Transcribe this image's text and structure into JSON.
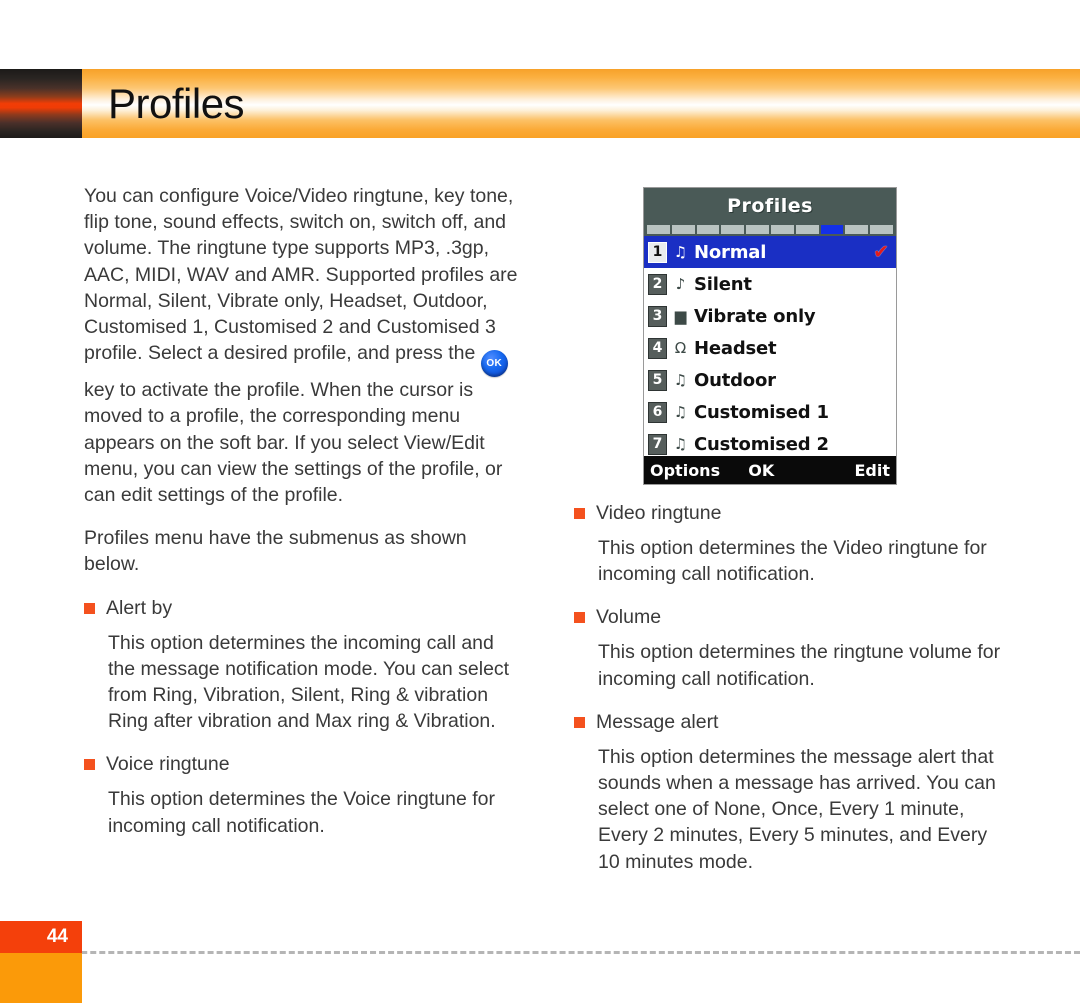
{
  "header": {
    "title": "Profiles"
  },
  "colors": {
    "accent_orange": "#fb9a09",
    "accent_red": "#f4400b",
    "bullet": "#f4511e",
    "phone_select": "#1a2fc4",
    "phone_title_bg": "#4a5a57",
    "check_red": "#e21b1b",
    "ok_key_blue": "#1769f0"
  },
  "left_column": {
    "intro_part1": "You can configure Voice/Video ringtune, key tone, flip tone, sound effects, switch on, switch off, and volume. The ringtune type supports MP3, .3gp, AAC, MIDI, WAV and AMR. Supported profiles are Normal, Silent, Vibrate only, Headset, Outdoor, Customised 1, Customised 2 and Customised 3 profile. Select a desired profile, and press the ",
    "ok_key_label": "OK",
    "intro_part2": " key to activate the profile. When the cursor is moved to a profile, the corresponding menu appears on the soft bar. If you select View/Edit menu, you can view the settings of the profile, or can edit settings of the profile.",
    "submenu_intro": "Profiles menu have the submenus as shown below.",
    "sections": [
      {
        "title": "Alert by",
        "body": "This option determines the incoming call and the message notification mode. You can select from Ring, Vibration, Silent, Ring & vibration Ring after vibration and Max ring & Vibration."
      },
      {
        "title": "Voice ringtune",
        "body": "This option determines the Voice ringtune for incoming call notification."
      }
    ]
  },
  "right_column": {
    "sections": [
      {
        "title": "Video ringtune",
        "body": "This option determines the Video ringtune for incoming call notification."
      },
      {
        "title": "Volume",
        "body": "This option determines the ringtune volume for incoming call notification."
      },
      {
        "title": "Message alert",
        "body": "This option determines the message alert that sounds when a message has arrived. You can select one of None, Once, Every 1 minute, Every 2 minutes, Every 5 minutes, and Every 10 minutes mode."
      }
    ]
  },
  "phone_screen": {
    "title": "Profiles",
    "tab_count": 10,
    "tab_active_index": 7,
    "items": [
      {
        "num": "1",
        "icon": "music-note-icon",
        "glyph": "♫",
        "label": "Normal",
        "selected": true,
        "checked": true
      },
      {
        "num": "2",
        "icon": "muted-note-icon",
        "glyph": "♪",
        "label": "Silent",
        "selected": false,
        "checked": false
      },
      {
        "num": "3",
        "icon": "vibrate-phone-icon",
        "glyph": "▆",
        "label": "Vibrate only",
        "selected": false,
        "checked": false
      },
      {
        "num": "4",
        "icon": "headset-icon",
        "glyph": "Ω",
        "label": "Headset",
        "selected": false,
        "checked": false
      },
      {
        "num": "5",
        "icon": "outdoor-notes-icon",
        "glyph": "♫",
        "label": "Outdoor",
        "selected": false,
        "checked": false
      },
      {
        "num": "6",
        "icon": "custom1-notes-icon",
        "glyph": "♫",
        "label": "Customised 1",
        "selected": false,
        "checked": false
      },
      {
        "num": "7",
        "icon": "custom2-notes-icon",
        "glyph": "♫",
        "label": "Customised 2",
        "selected": false,
        "checked": false
      }
    ],
    "check_glyph": "✔",
    "softbar": {
      "left": "Options",
      "center": "OK",
      "right": "Edit"
    }
  },
  "footer": {
    "page_number": "44"
  }
}
